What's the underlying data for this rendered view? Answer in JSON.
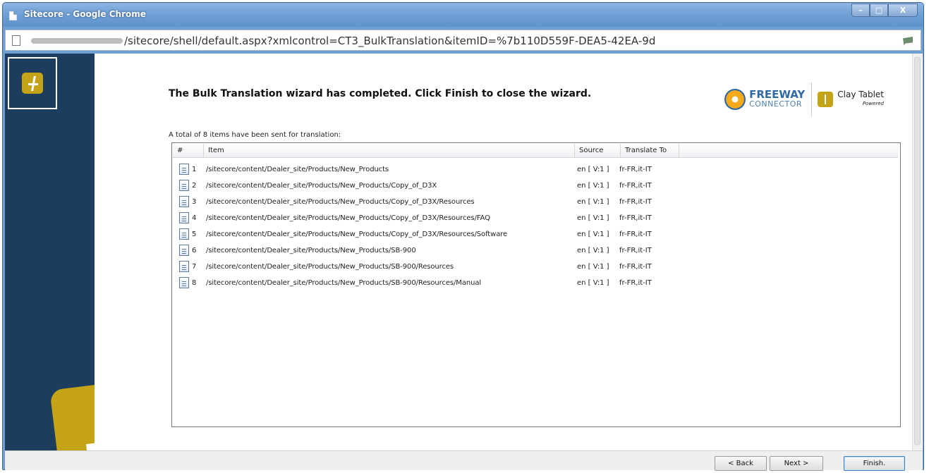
{
  "window": {
    "title": "Sitecore - Google Chrome",
    "controls": {
      "minimize": "–",
      "maximize": "□",
      "close": "X"
    }
  },
  "browser": {
    "url": "/sitecore/shell/default.aspx?xmlcontrol=CT3_BulkTranslation&itemID=%7b110D559F-DEA5-42EA-9d"
  },
  "wizard": {
    "heading": "The Bulk Translation wizard has completed. Click Finish to close the wizard.",
    "summary": "A total of 8 items have been sent for translation:",
    "brand": {
      "freeway_title": "FREEWAY",
      "freeway_sub": "CONNECTOR",
      "claytablet_title": "Clay Tablet",
      "claytablet_sub": "Powered"
    },
    "columns": {
      "num": "#",
      "item": "Item",
      "source": "Source",
      "translate": "Translate To"
    },
    "rows": [
      {
        "num": "1",
        "item": "/sitecore/content/Dealer_site/Products/New_Products",
        "source": "en [ V:1 ]",
        "translate": "fr-FR,it-IT"
      },
      {
        "num": "2",
        "item": "/sitecore/content/Dealer_site/Products/New_Products/Copy_of_D3X",
        "source": "en [ V:1 ]",
        "translate": "fr-FR,it-IT"
      },
      {
        "num": "3",
        "item": "/sitecore/content/Dealer_site/Products/New_Products/Copy_of_D3X/Resources",
        "source": "en [ V:1 ]",
        "translate": "fr-FR,it-IT"
      },
      {
        "num": "4",
        "item": "/sitecore/content/Dealer_site/Products/New_Products/Copy_of_D3X/Resources/FAQ",
        "source": "en [ V:1 ]",
        "translate": "fr-FR,it-IT"
      },
      {
        "num": "5",
        "item": "/sitecore/content/Dealer_site/Products/New_Products/Copy_of_D3X/Resources/Software",
        "source": "en [ V:1 ]",
        "translate": "fr-FR,it-IT"
      },
      {
        "num": "6",
        "item": "/sitecore/content/Dealer_site/Products/New_Products/SB-900",
        "source": "en [ V:1 ]",
        "translate": "fr-FR,it-IT"
      },
      {
        "num": "7",
        "item": "/sitecore/content/Dealer_site/Products/New_Products/SB-900/Resources",
        "source": "en [ V:1 ]",
        "translate": "fr-FR,it-IT"
      },
      {
        "num": "8",
        "item": "/sitecore/content/Dealer_site/Products/New_Products/SB-900/Resources/Manual",
        "source": "en [ V:1 ]",
        "translate": "fr-FR,it-IT"
      }
    ],
    "buttons": {
      "back": "< Back",
      "next": "Next >",
      "finish": "Finish."
    }
  }
}
